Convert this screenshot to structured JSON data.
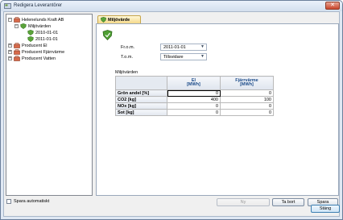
{
  "window": {
    "title": "Redigera Leverantörer",
    "close_label": "✕"
  },
  "tree": {
    "nodes": [
      {
        "label": "Helenelunds Kraft AB",
        "expander": "−"
      },
      {
        "label": "Miljövärden",
        "expander": "−"
      },
      {
        "label": "2010-01-01"
      },
      {
        "label": "2011-01-01"
      },
      {
        "label": "Producent El",
        "expander": "+"
      },
      {
        "label": "Producent Fjärrvärme",
        "expander": "+"
      },
      {
        "label": "Producent Vatten",
        "expander": "+"
      }
    ]
  },
  "tab": {
    "label": "Miljövärde"
  },
  "form": {
    "from_label": "Fr.o.m.",
    "from_value": "2011-01-01",
    "to_label": "T.o.m.",
    "to_value": "Tillsvidare",
    "dropdown_arrow": "▼"
  },
  "grid": {
    "section_label": "Miljövärden",
    "columns": [
      {
        "line1": "El",
        "line2": "[MWh]"
      },
      {
        "line1": "Fjärrvärme",
        "line2": "[MWh]"
      }
    ],
    "rows": [
      {
        "label": "Grön andel [%]",
        "values": [
          "0",
          "0"
        ]
      },
      {
        "label": "CO2 [kg]",
        "values": [
          "400",
          "100"
        ]
      },
      {
        "label": "NOx [kg]",
        "values": [
          "0",
          "0"
        ]
      },
      {
        "label": "Sot [kg]",
        "values": [
          "0",
          "0"
        ]
      }
    ]
  },
  "footer": {
    "autosave_label": "Spara automatiskt",
    "new_label": "Ny",
    "delete_label": "Ta bort",
    "save_label": "Spara",
    "close_label": "Stäng"
  }
}
